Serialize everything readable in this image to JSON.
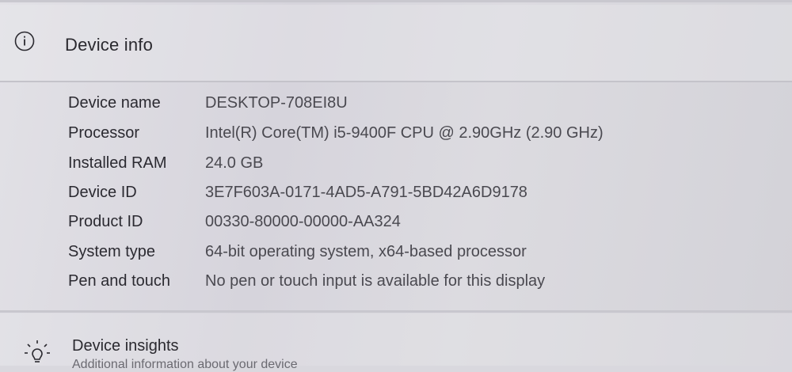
{
  "section": {
    "title": "Device info",
    "icon": "info-icon"
  },
  "specs": [
    {
      "label": "Device name",
      "value": "DESKTOP-708EI8U"
    },
    {
      "label": "Processor",
      "value": "Intel(R) Core(TM) i5-9400F CPU @ 2.90GHz (2.90 GHz)"
    },
    {
      "label": "Installed RAM",
      "value": "24.0 GB"
    },
    {
      "label": "Device ID",
      "value": "3E7F603A-0171-4AD5-A791-5BD42A6D9178"
    },
    {
      "label": "Product ID",
      "value": "00330-80000-00000-AA324"
    },
    {
      "label": "System type",
      "value": "64-bit operating system, x64-based processor"
    },
    {
      "label": "Pen and touch",
      "value": "No pen or touch input is available for this display"
    }
  ],
  "insights": {
    "title": "Device insights",
    "subtitle": "Additional information about your device",
    "icon": "lightbulb-icon"
  }
}
